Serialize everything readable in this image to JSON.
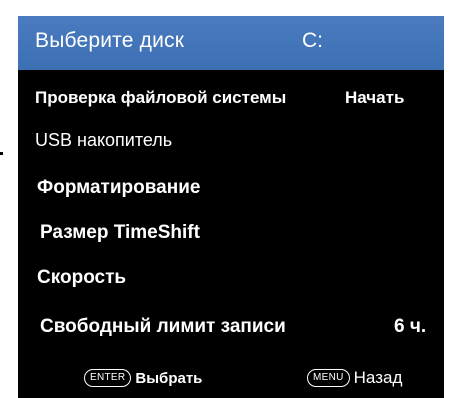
{
  "header": {
    "title": "Выберите диск",
    "value": "C:"
  },
  "menu": {
    "items": [
      {
        "label": "Проверка файловой системы",
        "value": "Начать"
      },
      {
        "label": "USB накопитель",
        "value": ""
      },
      {
        "label": "Форматирование",
        "value": ""
      },
      {
        "label": "Размер TimeShift",
        "value": ""
      },
      {
        "label": "Скорость",
        "value": ""
      },
      {
        "label": "Свободный лимит записи",
        "value": "6 ч."
      }
    ]
  },
  "footer": {
    "select_key": "ENTER",
    "select_label": "Выбрать",
    "back_key": "MENU",
    "back_label": "Назад"
  },
  "colors": {
    "header_bg": "#4a7bbf",
    "screen_bg": "#000000",
    "text": "#ffffff"
  }
}
